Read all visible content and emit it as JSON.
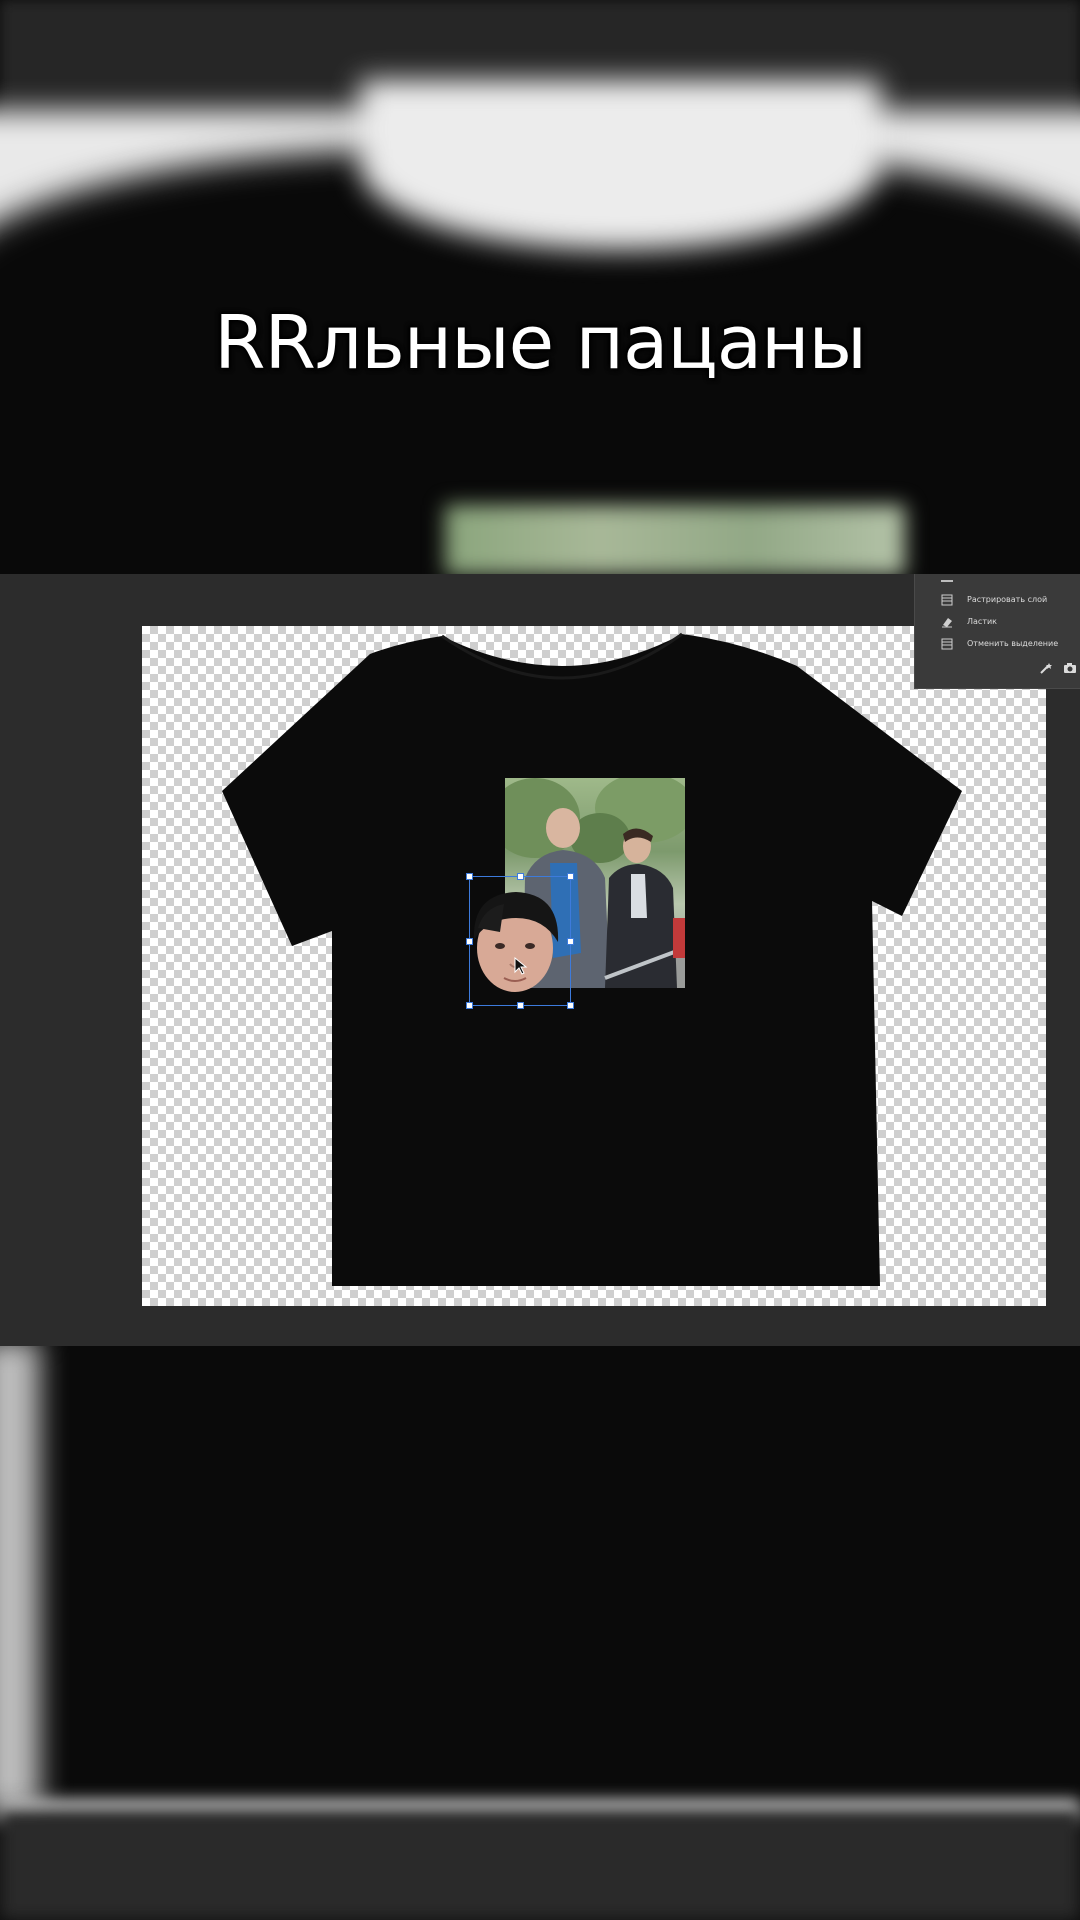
{
  "caption": {
    "text": "RRльные пацаны"
  },
  "context_menu": {
    "items": [
      {
        "label": "Растрировать слой",
        "icon": "layer-icon"
      },
      {
        "label": "Ластик",
        "icon": "eraser-icon"
      },
      {
        "label": "Отменить выделение",
        "icon": "deselect-icon"
      }
    ],
    "bottom_icons": [
      "magic-wand-icon",
      "camera-icon"
    ]
  },
  "canvas": {
    "background": "transparent-checkerboard",
    "tshirt_color": "#0b0b0b"
  },
  "colors": {
    "editor_bg": "#2c2c2c",
    "selection": "#3d7bdc"
  }
}
